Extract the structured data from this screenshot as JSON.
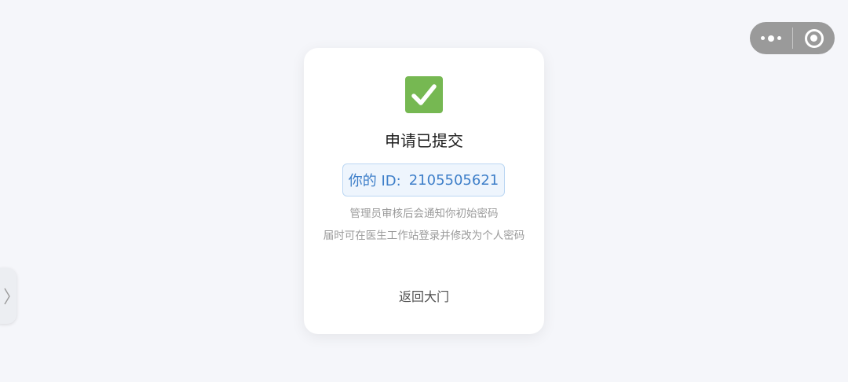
{
  "window": {
    "menu_icon": "more-dots-icon",
    "close_icon": "target-circle-icon",
    "side_tab_glyph": "⟩"
  },
  "card": {
    "status_icon": "check-mark-icon",
    "status_color": "#76b852",
    "title": "申请已提交",
    "id_label": "你的 ID:",
    "id_value": "2105505621",
    "message_line1": "管理员审核后会通知你初始密码",
    "message_line2": "届时可在医生工作站登录并修改为个人密码",
    "back_link": "返回大门"
  },
  "colors": {
    "background": "#f5f6fa",
    "card": "#ffffff",
    "id_text": "#3e7fc9",
    "id_border": "#bcd7f3",
    "id_fill": "#eef5fd",
    "capsule": "#9a9a9a"
  }
}
